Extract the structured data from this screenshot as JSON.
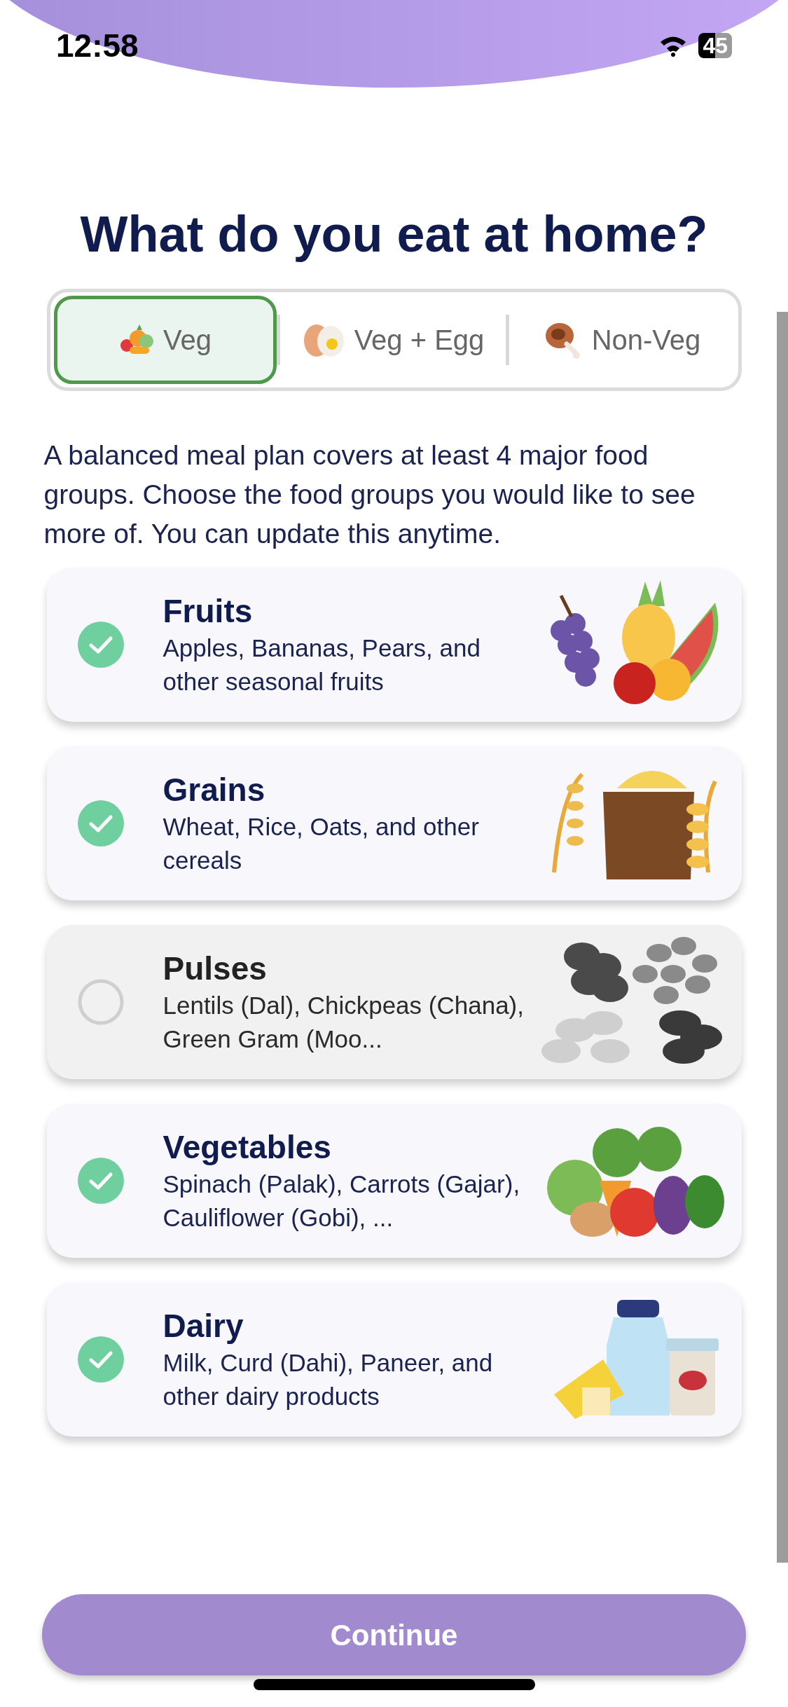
{
  "status_bar": {
    "time": "12:58",
    "battery": "45"
  },
  "title": "What do you eat at home?",
  "diet_tabs": [
    {
      "label": "Veg",
      "selected": true
    },
    {
      "label": "Veg + Egg",
      "selected": false
    },
    {
      "label": "Non-Veg",
      "selected": false
    }
  ],
  "intro": "A balanced meal plan covers at least 4 major food groups. Choose the food groups you would like to see more of. You can update this anytime.",
  "food_groups": [
    {
      "name": "Fruits",
      "description": "Apples, Bananas, Pears, and other seasonal fruits",
      "selected": true
    },
    {
      "name": "Grains",
      "description": "Wheat, Rice, Oats, and other cereals",
      "selected": true
    },
    {
      "name": "Pulses",
      "description": "Lentils (Dal), Chickpeas (Chana), Green Gram (Moo...",
      "selected": false
    },
    {
      "name": "Vegetables",
      "description": "Spinach (Palak), Carrots (Gajar), Cauliflower (Gobi), ...",
      "selected": true
    },
    {
      "name": "Dairy",
      "description": "Milk, Curd (Dahi), Paneer, and other dairy products",
      "selected": true
    }
  ],
  "continue_button": "Continue"
}
